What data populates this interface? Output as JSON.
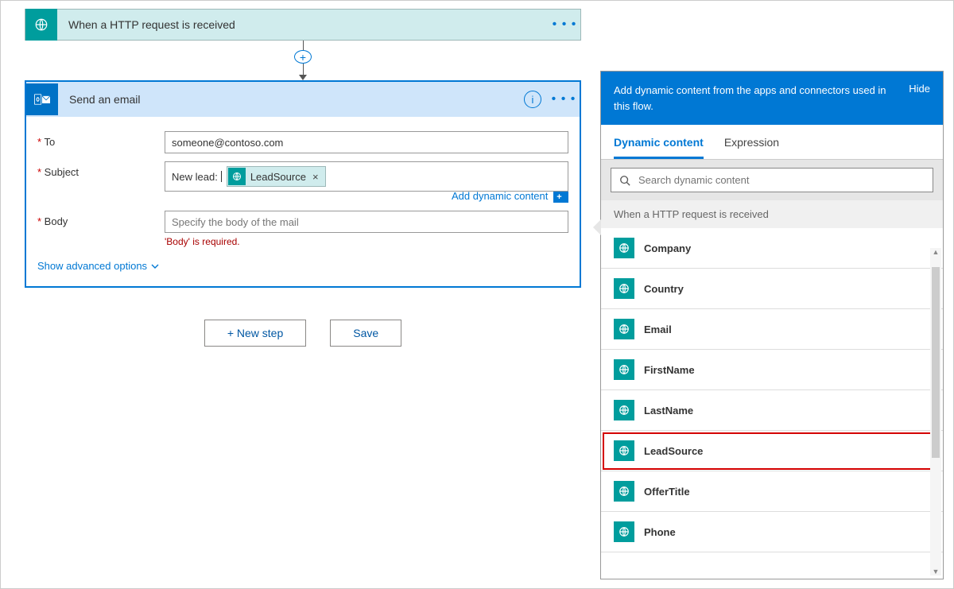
{
  "trigger": {
    "title": "When a HTTP request is received"
  },
  "action": {
    "title": "Send an email",
    "fields": {
      "to_label": "To",
      "to_value": "someone@contoso.com",
      "subject_label": "Subject",
      "subject_prefix": "New lead:",
      "subject_token": "LeadSource",
      "body_label": "Body",
      "body_placeholder": "Specify the body of the mail",
      "body_error": "'Body' is required."
    },
    "add_dynamic_link": "Add dynamic content",
    "advanced_link": "Show advanced options"
  },
  "buttons": {
    "new_step": "+ New step",
    "save": "Save"
  },
  "dynamic_panel": {
    "header_text": "Add dynamic content from the apps and connectors used in this flow.",
    "hide_label": "Hide",
    "tabs": {
      "dynamic": "Dynamic content",
      "expression": "Expression"
    },
    "search_placeholder": "Search dynamic content",
    "group_header": "When a HTTP request is received",
    "items": [
      "Company",
      "Country",
      "Email",
      "FirstName",
      "LastName",
      "LeadSource",
      "OfferTitle",
      "Phone"
    ],
    "highlighted_item": "LeadSource"
  }
}
